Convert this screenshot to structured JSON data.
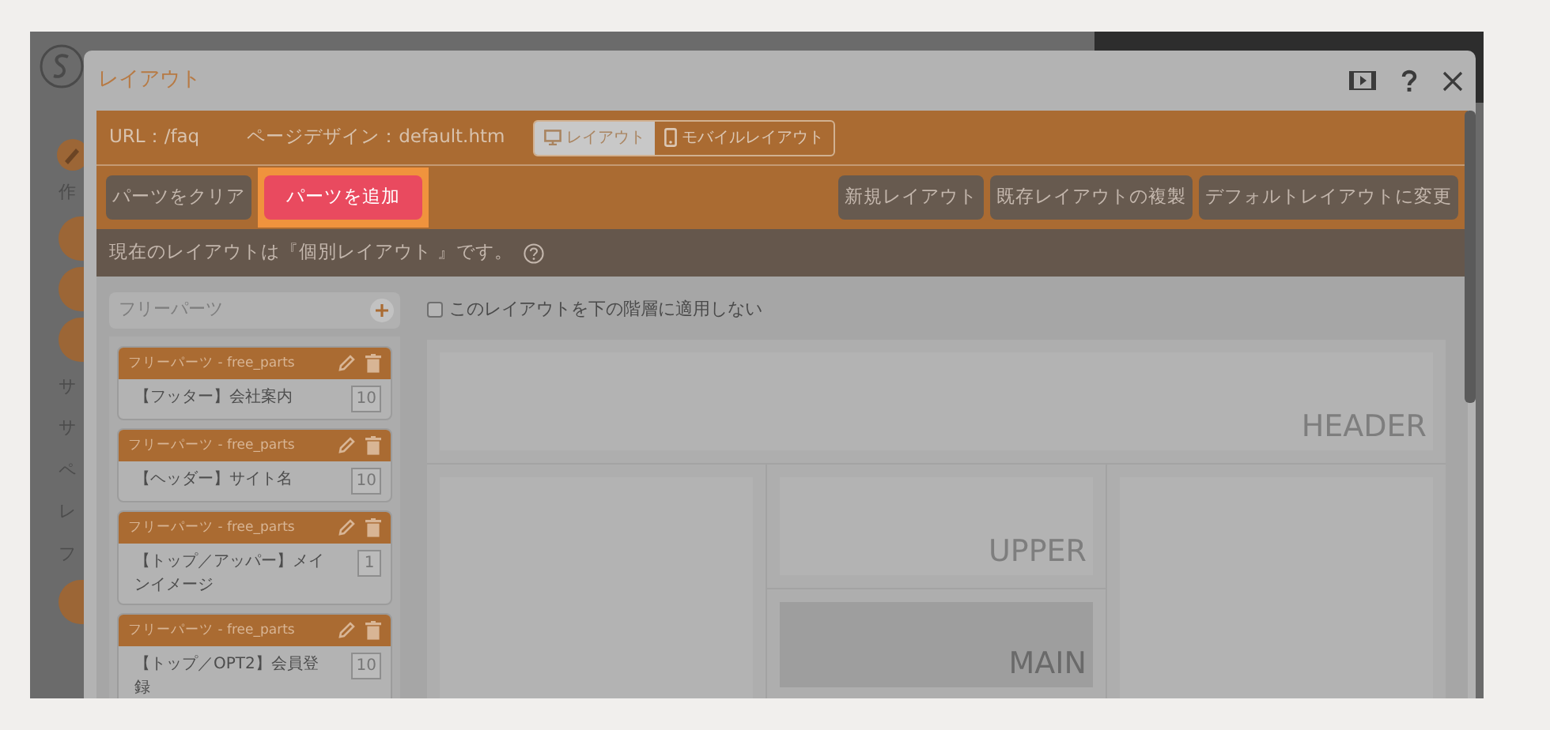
{
  "app": {
    "sidebar_items": [
      {
        "label": "作",
        "kind": "icon"
      },
      {
        "kind": "circle"
      },
      {
        "kind": "circle"
      },
      {
        "kind": "circle"
      },
      {
        "label": "サ",
        "kind": "text"
      },
      {
        "label": "サ",
        "kind": "text"
      },
      {
        "label": "ペ",
        "kind": "text"
      },
      {
        "label": "レ",
        "kind": "text"
      },
      {
        "label": "フ",
        "kind": "text"
      },
      {
        "kind": "circle"
      }
    ]
  },
  "dialog": {
    "title": "レイアウト",
    "url": "URL：/faq",
    "page_design": "ページデザイン：default.htm",
    "view_tabs": [
      {
        "label": "レイアウト",
        "kind": "desktop",
        "selected": true
      },
      {
        "label": "モバイルレイアウト",
        "kind": "mobile",
        "selected": false
      }
    ],
    "actions_left": [
      {
        "label": "パーツをクリア",
        "highlighted": false
      },
      {
        "label": "パーツを追加",
        "highlighted": true
      }
    ],
    "actions_right": [
      "新規レイアウト",
      "既存レイアウトの複製",
      "デフォルトレイアウトに変更"
    ],
    "notice": "現在のレイアウトは『個別レイアウト 』です。",
    "parts_panel": {
      "title": "フリーパーツ",
      "parts": [
        {
          "category": "フリーパーツ - free_parts",
          "name": "【フッター】会社案内",
          "number": "10"
        },
        {
          "category": "フリーパーツ - free_parts",
          "name": "【ヘッダー】サイト名",
          "number": "10"
        },
        {
          "category": "フリーパーツ - free_parts",
          "name": "【トップ／アッパー】メインイメージ",
          "number": "1"
        },
        {
          "category": "フリーパーツ - free_parts",
          "name": "【トップ／OPT2】会員登録",
          "number": "10"
        }
      ]
    },
    "apply_checkbox": {
      "label": "このレイアウトを下の階層に適用しない",
      "checked": false
    },
    "regions": [
      {
        "kind": "header",
        "label": "HEADER",
        "selected": false
      },
      {
        "kind": "left",
        "selected": false
      },
      {
        "kind": "upper",
        "label": "UPPER",
        "selected": false
      },
      {
        "kind": "main",
        "label": "MAIN",
        "selected": true
      },
      {
        "kind": "right",
        "selected": false
      }
    ]
  }
}
